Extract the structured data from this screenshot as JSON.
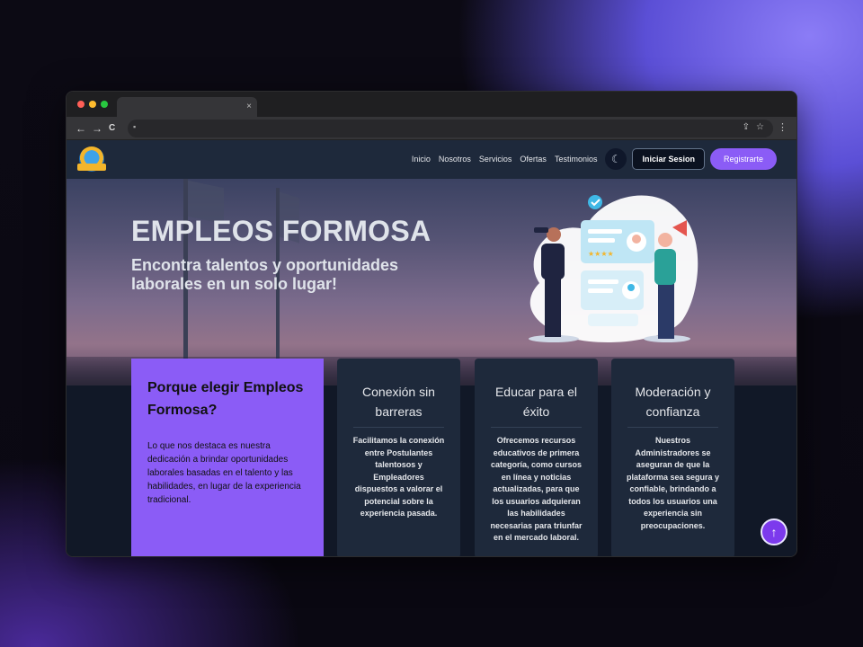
{
  "browser": {
    "tab_close": "×",
    "back": "←",
    "forward": "→",
    "reload": "C"
  },
  "nav": {
    "links": [
      "Inicio",
      "Nosotros",
      "Servicios",
      "Ofertas",
      "Testimonios"
    ],
    "login_label": "Iniciar Sesion",
    "register_label": "Registrarte"
  },
  "hero": {
    "title": "EMPLEOS FORMOSA",
    "subtitle": "Encontra talentos y oportunidades laborales en un solo lugar!"
  },
  "why": {
    "title": "Porque elegir Empleos Formosa?",
    "text": "Lo que nos destaca es nuestra dedicación a brindar oportunidades laborales basadas en el talento y las habilidades, en lugar de la experiencia tradicional."
  },
  "features": [
    {
      "title": "Conexión sin barreras",
      "text": "Facilitamos la conexión entre Postulantes talentosos y Empleadores dispuestos a valorar el potencial sobre la experiencia pasada."
    },
    {
      "title": "Educar para el éxito",
      "text": "Ofrecemos recursos educativos de primera categoría, como cursos en línea y noticias actualizadas, para que los usuarios adquieran las habilidades necesarias para triunfar en el mercado laboral."
    },
    {
      "title": "Moderación y confianza",
      "text": "Nuestros Administradores se aseguran de que la plataforma sea segura y confiable, brindando a todos los usuarios una experiencia sin preocupaciones."
    }
  ],
  "colors": {
    "accent": "#8b5cf6",
    "navbar": "#1e293b",
    "card": "#1e293b",
    "page_bg": "#111827"
  }
}
